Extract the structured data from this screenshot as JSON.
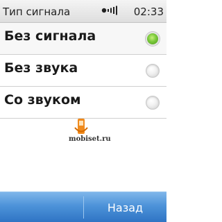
{
  "status_bar": {
    "title": "Тип сигнала",
    "time": "02:33",
    "icon": "vibrate-ring-icon"
  },
  "options": [
    {
      "label": "Без сигнала",
      "selected": true
    },
    {
      "label": "Без звука",
      "selected": false
    },
    {
      "label": "Со звуком",
      "selected": false
    }
  ],
  "watermark": {
    "text": "mobiset.ru"
  },
  "softkeys": {
    "right_label": "Назад"
  },
  "colors": {
    "accent": "#4d93d9",
    "selected_radio": "#79c83a"
  }
}
